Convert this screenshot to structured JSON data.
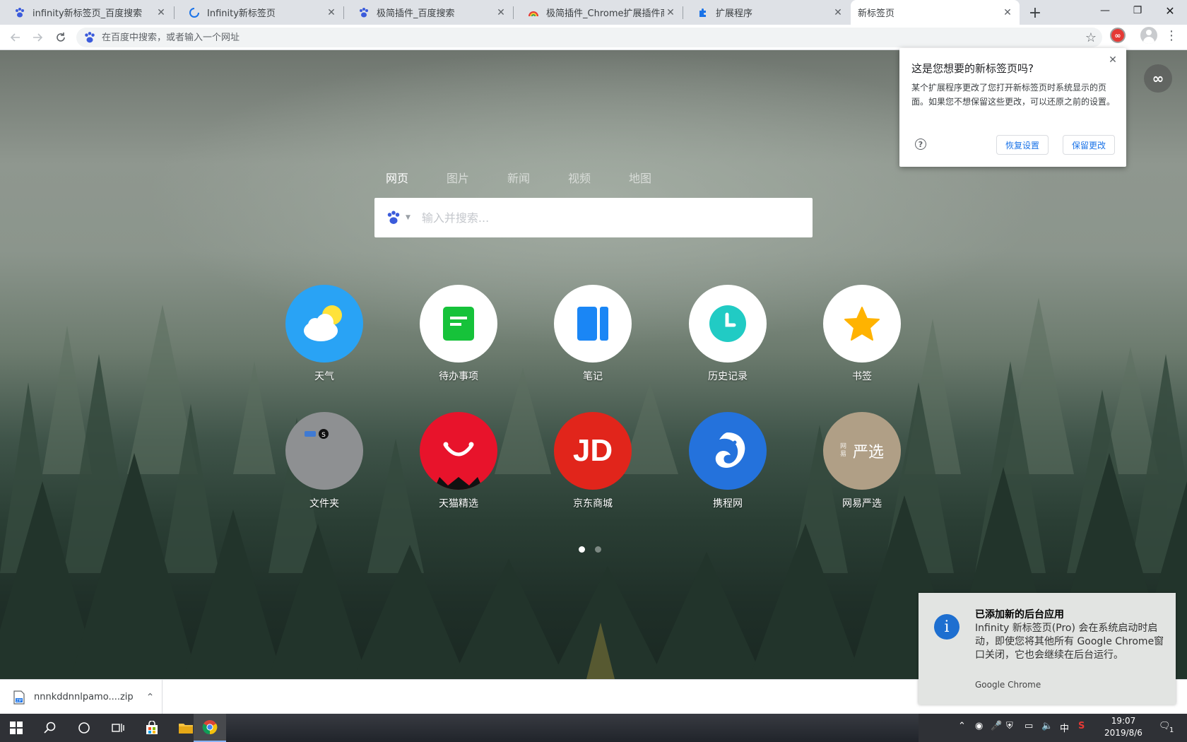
{
  "tabs": [
    {
      "title": "infinity新标签页_百度搜索",
      "favicon": "baidu-paw-icon"
    },
    {
      "title": "Infinity新标签页",
      "favicon": "loading-spinner-icon"
    },
    {
      "title": "极简插件_百度搜索",
      "favicon": "baidu-paw-icon"
    },
    {
      "title": "极简插件_Chrome扩展插件商店",
      "favicon": "rainbow-icon"
    },
    {
      "title": "扩展程序",
      "favicon": "puzzle-icon"
    },
    {
      "title": "新标签页",
      "favicon": "",
      "active": true
    }
  ],
  "omnibox": {
    "placeholder": "在百度中搜索，或者输入一个网址"
  },
  "search": {
    "tabs": [
      "网页",
      "图片",
      "新闻",
      "视频",
      "地图"
    ],
    "active_tab": "网页",
    "placeholder": "输入并搜索..."
  },
  "apps": [
    {
      "label": "天气",
      "icon": "weather-icon",
      "bg": "#29a3f5"
    },
    {
      "label": "待办事项",
      "icon": "todo-icon",
      "bg": "#ffffff"
    },
    {
      "label": "笔记",
      "icon": "note-icon",
      "bg": "#ffffff"
    },
    {
      "label": "历史记录",
      "icon": "history-clock-icon",
      "bg": "#ffffff"
    },
    {
      "label": "书签",
      "icon": "bookmark-star-icon",
      "bg": "#ffffff"
    },
    {
      "label": "文件夹",
      "icon": "folder-icon",
      "bg": "#8e9092"
    },
    {
      "label": "天猫精选",
      "icon": "tmall-icon",
      "bg": "#e8132b"
    },
    {
      "label": "京东商城",
      "icon": "jd-icon",
      "bg": "#e1251b",
      "mark": "JD"
    },
    {
      "label": "携程网",
      "icon": "ctrip-dolphin-icon",
      "bg": "#2472dc"
    },
    {
      "label": "网易严选",
      "icon": "yanxuan-icon",
      "bg": "#b09f86",
      "mark": "严选",
      "mark_small": "网易"
    }
  ],
  "pager": {
    "pages": 2,
    "current": 1
  },
  "popup": {
    "title": "这是您想要的新标签页吗?",
    "body": "某个扩展程序更改了您打开新标签页时系统显示的页面。如果您不想保留这些更改，可以还原之前的设置。",
    "restore_label": "恢复设置",
    "keep_label": "保留更改"
  },
  "download": {
    "filename": "nnnkddnnlpamo....zip"
  },
  "notification": {
    "title": "已添加新的后台应用",
    "body": "Infinity 新标签页(Pro) 会在系统启动时启动，即使您将其他所有 Google Chrome窗口关闭，它也会继续在后台运行。",
    "source": "Google Chrome"
  },
  "taskbar": {
    "time": "19:07",
    "date": "2019/8/6",
    "ime": "中",
    "notif_count": "1"
  },
  "colors": {
    "accent": "#1a73e8",
    "tabstrip": "#dee1e6"
  }
}
